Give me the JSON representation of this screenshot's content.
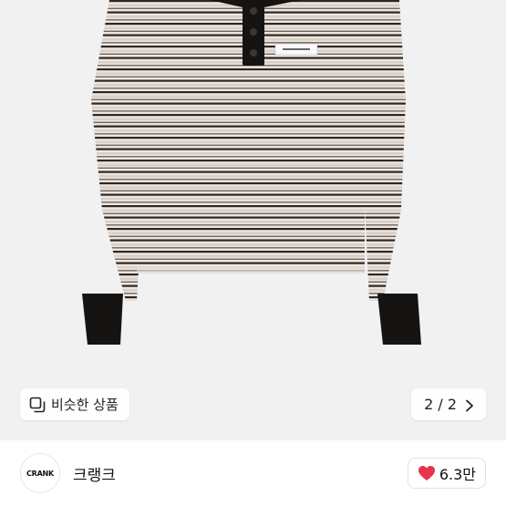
{
  "similar": {
    "label": "비슷한 상품",
    "icon": "similar-items-icon"
  },
  "pager": {
    "text": "2 / 2",
    "icon": "chevron-right-icon"
  },
  "shop": {
    "avatar_text": "CRANK",
    "name": "크랭크"
  },
  "like": {
    "count": "6.3만",
    "icon": "heart-icon",
    "color": "#e8344e"
  },
  "colors": {
    "stripe_dark": "#2b2726",
    "stripe_light": "#d9d0c8",
    "knit": "#ede6df",
    "placket": "#161413"
  }
}
